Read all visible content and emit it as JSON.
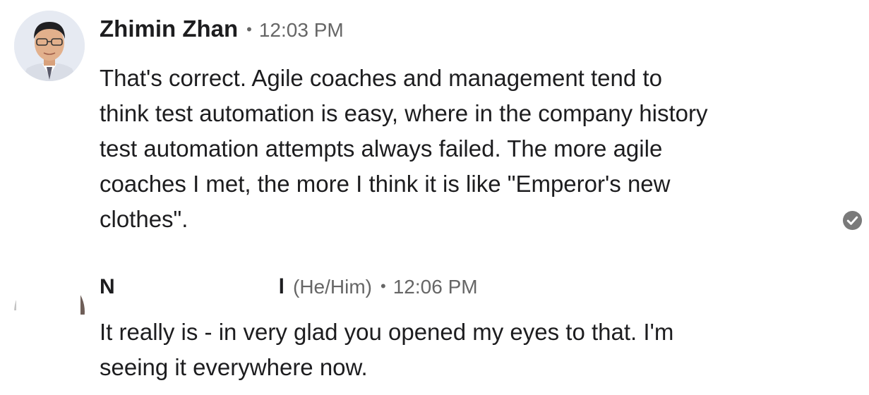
{
  "messages": [
    {
      "sender_name": "Zhimin Zhan",
      "separator": "•",
      "timestamp": "12:03 PM",
      "lines": [
        "That's correct. Agile coaches and management tend to",
        "think test automation is easy, where in the company history",
        "test automation attempts always failed. The more agile",
        "coaches I met, the more I think it is like \"Emperor's new",
        "clothes\"."
      ],
      "read_receipt_icon": "check-circle-icon"
    },
    {
      "sender_name_start": "N",
      "sender_name_end": "l",
      "pronouns": "(He/Him)",
      "separator": "•",
      "timestamp": "12:06 PM",
      "lines": [
        "It really is - in very glad you opened my eyes to that. I'm",
        "seeing it everywhere now."
      ]
    }
  ],
  "colors": {
    "primary_text": "#1d1d1f",
    "secondary_text": "#666666",
    "receipt_icon": "#7a7a7a",
    "background": "#ffffff"
  }
}
